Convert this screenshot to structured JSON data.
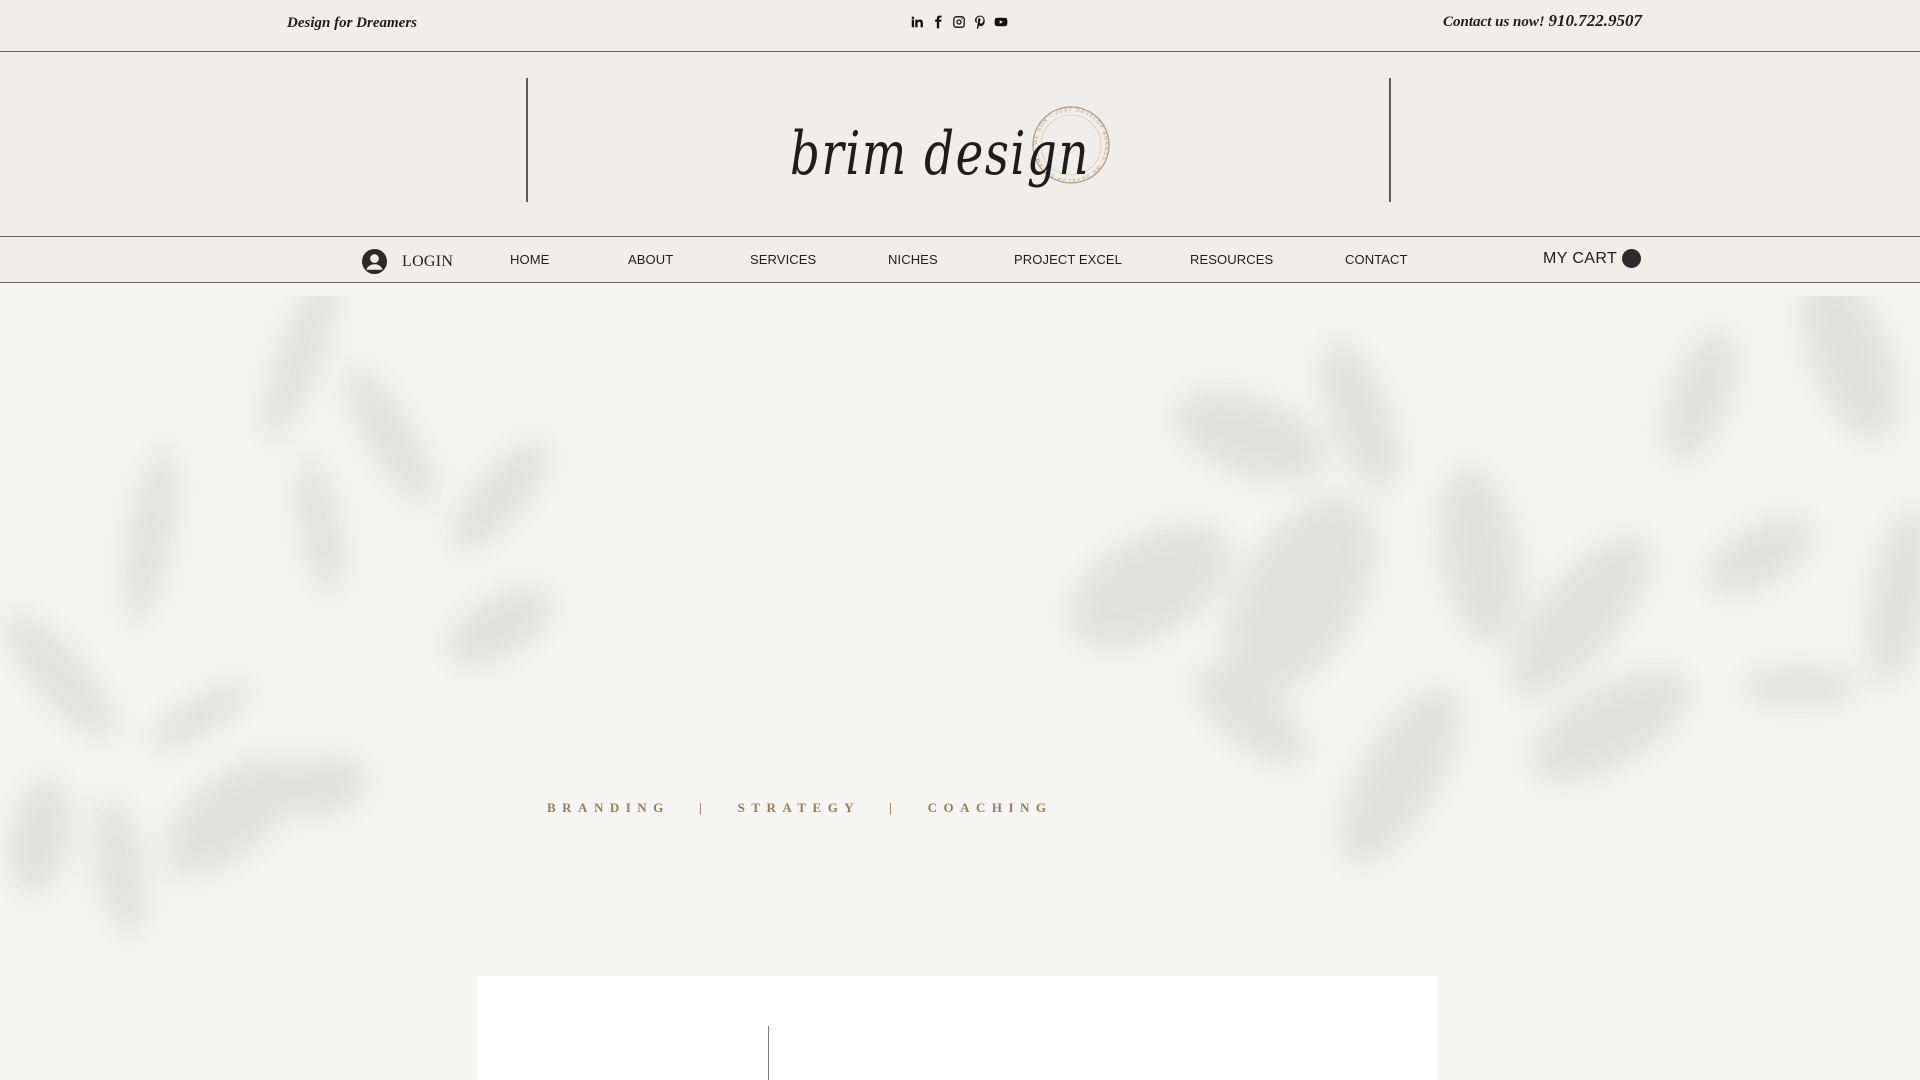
{
  "topbar": {
    "tagline": "Design for Dreamers",
    "social_icons": [
      "linkedin-icon",
      "facebook-icon",
      "instagram-icon",
      "pinterest-icon",
      "youtube-icon"
    ],
    "contact_text": "Contact us now!",
    "contact_phone": "910.722.9507"
  },
  "logo": {
    "wordmark": "brim design",
    "seal_text": "WE DON'T JUST DEVELOP BRANDS, WE DEVELOP DREAMS"
  },
  "nav": {
    "login_label": "LOGIN",
    "items": [
      "HOME",
      "ABOUT",
      "SERVICES",
      "NICHES",
      "PROJECT EXCEL",
      "RESOURCES",
      "CONTACT"
    ],
    "cart_label": "MY CART"
  },
  "hero": {
    "tagline": "BRANDING   |   STRATEGY   |   COACHING"
  },
  "colors": {
    "background": "#f4f4f0",
    "header_bg": "#efeeea",
    "accent_gold": "#9a7d5c",
    "seal": "#b89b7e",
    "text": "#1a1a1a"
  }
}
